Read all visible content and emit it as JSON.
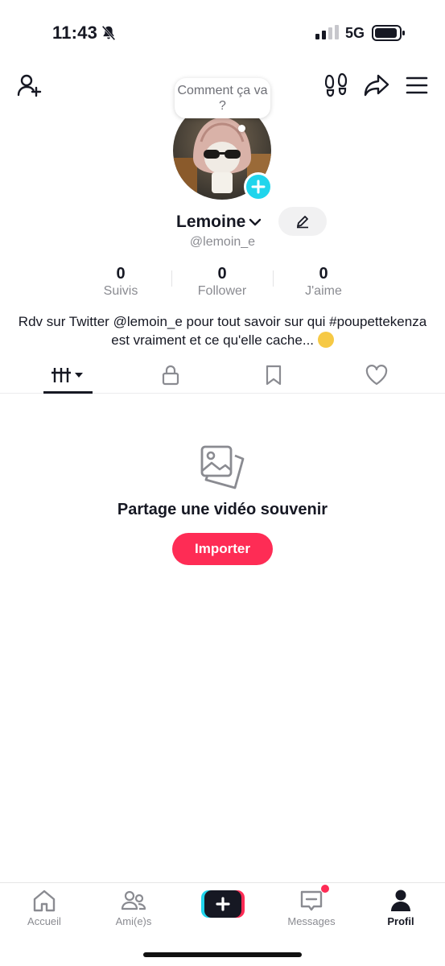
{
  "status_bar": {
    "time": "11:43",
    "network": "5G",
    "icons": [
      "bell-muted-icon",
      "signal-icon",
      "battery-icon"
    ]
  },
  "top_bar": {
    "icons": [
      "add-friend-icon",
      "footprint-icon",
      "share-icon",
      "menu-icon"
    ]
  },
  "profile": {
    "bubble_text": "Comment ça va ?",
    "display_name": "Lemoine",
    "username": "@lemoin_e",
    "stats": [
      {
        "value": "0",
        "label": "Suivis"
      },
      {
        "value": "0",
        "label": "Follower"
      },
      {
        "value": "0",
        "label": "J'aime"
      }
    ],
    "bio": "Rdv sur Twitter @lemoin_e pour tout savoir sur qui #poupettekenza est vraiment et ce qu'elle cache... "
  },
  "tabs": [
    "videos-grid-icon",
    "lock-icon",
    "bookmark-icon",
    "heart-icon"
  ],
  "empty_state": {
    "title": "Partage une vidéo souvenir",
    "button": "Importer"
  },
  "bottom_nav": {
    "items": [
      {
        "label": "Accueil",
        "icon": "home-icon"
      },
      {
        "label": "Ami(e)s",
        "icon": "friends-icon"
      },
      {
        "label": "Messages",
        "icon": "inbox-icon"
      },
      {
        "label": "Profil",
        "icon": "profile-icon"
      }
    ],
    "active": "Profil"
  },
  "colors": {
    "accent": "#fe2c55",
    "cyan": "#20d5ec",
    "text": "#161823",
    "muted": "#8a8b91"
  }
}
